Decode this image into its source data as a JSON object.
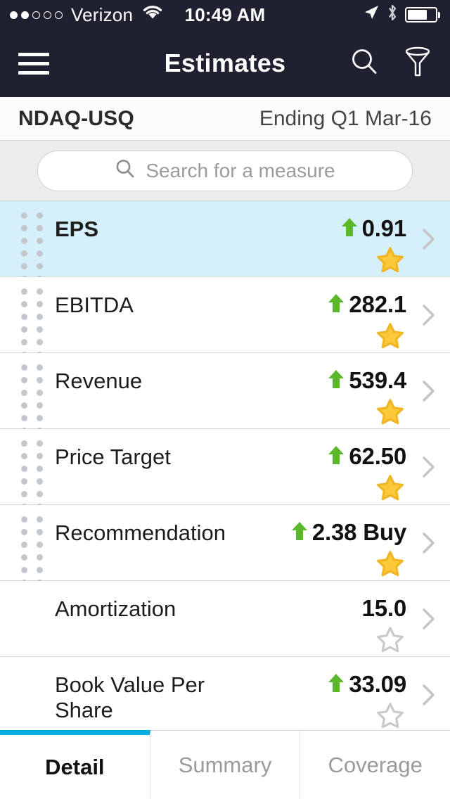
{
  "status_bar": {
    "signal_filled": 2,
    "signal_total": 5,
    "carrier": "Verizon",
    "wifi_icon": "wifi-icon",
    "time": "10:49 AM",
    "location_icon": "location-arrow-icon",
    "bluetooth_icon": "bluetooth-icon",
    "battery_icon": "battery-icon",
    "battery_level": 72
  },
  "nav": {
    "menu_icon": "hamburger-menu-icon",
    "title": "Estimates",
    "search_icon": "search-icon",
    "filter_icon": "funnel-filter-icon"
  },
  "subheader": {
    "ticker": "NDAQ-USQ",
    "period": "Ending Q1 Mar-16"
  },
  "search": {
    "icon": "search-icon",
    "placeholder": "Search for a measure",
    "value": ""
  },
  "colors": {
    "header_bg": "#1f2130",
    "selected_row": "#d5f0fa",
    "accent": "#00ade0",
    "up_arrow": "#5cb82b",
    "star_on": "#fcc93a",
    "star_off": "#c9c9c9",
    "strip_bg": "#ececec"
  },
  "measures": [
    {
      "label": "EPS",
      "value": "0.91",
      "trend": "up",
      "starred": true,
      "selected": true,
      "draggable": true,
      "chevron_icon": "chevron-right-icon",
      "star_icon": "star-filled-icon",
      "arrow_icon": "arrow-up-icon"
    },
    {
      "label": "EBITDA",
      "value": "282.1",
      "trend": "up",
      "starred": true,
      "selected": false,
      "draggable": true,
      "chevron_icon": "chevron-right-icon",
      "star_icon": "star-filled-icon",
      "arrow_icon": "arrow-up-icon"
    },
    {
      "label": "Revenue",
      "value": "539.4",
      "trend": "up",
      "starred": true,
      "selected": false,
      "draggable": true,
      "chevron_icon": "chevron-right-icon",
      "star_icon": "star-filled-icon",
      "arrow_icon": "arrow-up-icon"
    },
    {
      "label": "Price Target",
      "value": "62.50",
      "trend": "up",
      "starred": true,
      "selected": false,
      "draggable": true,
      "chevron_icon": "chevron-right-icon",
      "star_icon": "star-filled-icon",
      "arrow_icon": "arrow-up-icon"
    },
    {
      "label": "Recommendation",
      "value": "2.38 Buy",
      "trend": "up",
      "starred": true,
      "selected": false,
      "draggable": true,
      "chevron_icon": "chevron-right-icon",
      "star_icon": "star-filled-icon",
      "arrow_icon": "arrow-up-icon"
    },
    {
      "label": "Amortization",
      "value": "15.0",
      "trend": "none",
      "starred": false,
      "selected": false,
      "draggable": false,
      "chevron_icon": "chevron-right-icon",
      "star_icon": "star-outline-icon"
    },
    {
      "label": "Book Value Per Share",
      "value": "33.09",
      "trend": "up",
      "starred": false,
      "selected": false,
      "draggable": false,
      "chevron_icon": "chevron-right-icon",
      "star_icon": "star-outline-icon",
      "arrow_icon": "arrow-up-icon"
    }
  ],
  "tabs": [
    {
      "label": "Detail",
      "active": true
    },
    {
      "label": "Summary",
      "active": false
    },
    {
      "label": "Coverage",
      "active": false
    }
  ]
}
